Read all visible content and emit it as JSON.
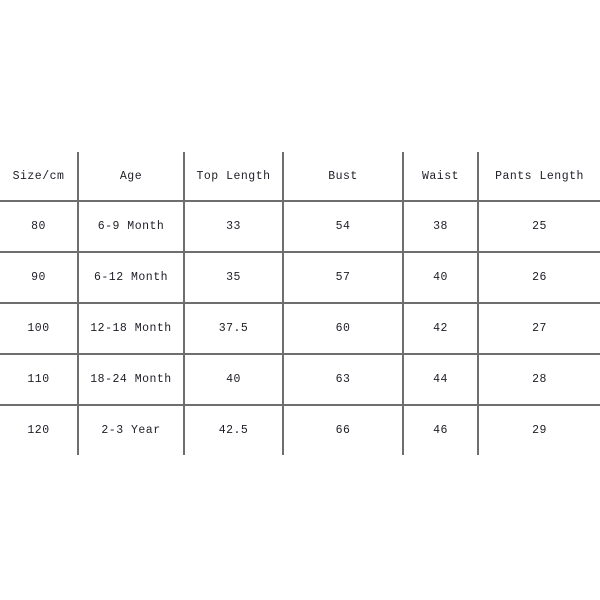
{
  "table": {
    "columns": [
      "Size/cm",
      "Age",
      "Top Length",
      "Bust",
      "Waist",
      "Pants Length"
    ],
    "rows": [
      {
        "size_cm": "80",
        "age": "6-9 Month",
        "top_length": "33",
        "bust": "54",
        "waist": "38",
        "pants_length": "25"
      },
      {
        "size_cm": "90",
        "age": "6-12 Month",
        "top_length": "35",
        "bust": "57",
        "waist": "40",
        "pants_length": "26"
      },
      {
        "size_cm": "100",
        "age": "12-18 Month",
        "top_length": "37.5",
        "bust": "60",
        "waist": "42",
        "pants_length": "27"
      },
      {
        "size_cm": "110",
        "age": "18-24 Month",
        "top_length": "40",
        "bust": "63",
        "waist": "44",
        "pants_length": "28"
      },
      {
        "size_cm": "120",
        "age": "2-3 Year",
        "top_length": "42.5",
        "bust": "66",
        "waist": "46",
        "pants_length": "29"
      }
    ]
  },
  "colors": {
    "background": "#ffffff",
    "rule": "#6e6e6e",
    "text": "#1d1d26"
  }
}
